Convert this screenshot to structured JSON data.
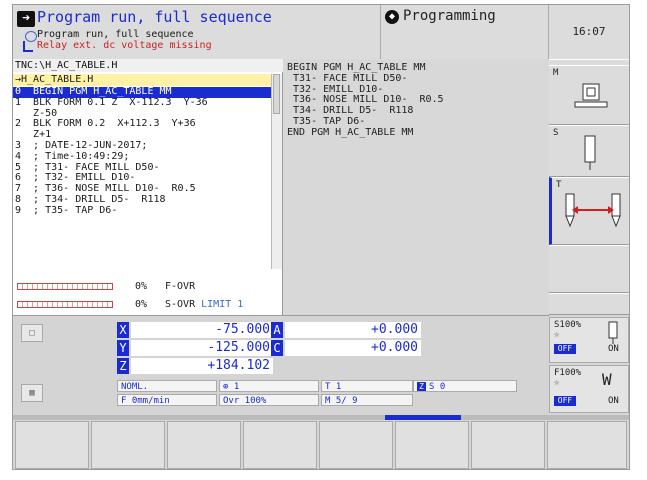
{
  "header": {
    "mode_title": "Program run, full sequence",
    "mode_subtitle": "Program run, full sequence",
    "error_message": "Relay ext. dc voltage missing",
    "secondary_mode": "Programming",
    "clock": "16:07"
  },
  "program": {
    "path": "TNC:\\H_AC_TABLE.H",
    "file": "→H_AC_TABLE.H",
    "lines": [
      "0  BEGIN PGM H_AC_TABLE MM",
      "1  BLK FORM 0.1 Z  X-112.3  Y-36",
      "   Z-50",
      "2  BLK FORM 0.2  X+112.3  Y+36",
      "   Z+1",
      "3  ; DATE-12-JUN-2017;",
      "4  ; Time-10:49:29;",
      "5  ; T31- FACE MILL D50-",
      "6  ; T32- EMILL D10-",
      "7  ; T36- NOSE MILL D10-  R0.5",
      "8  ; T34- DRILL D5-  R118",
      "9  ; T35- TAP D6-"
    ]
  },
  "overrides": {
    "f_pct": "0%",
    "f_name": "F-OVR",
    "s_pct": "0%",
    "s_name": "S-OVR",
    "s_limit": "LIMIT 1"
  },
  "pgm_view": {
    "lines": [
      "BEGIN PGM H_AC_TABLE MM",
      " T31- FACE MILL D50-",
      " T32- EMILL D10-",
      " T36- NOSE MILL D10-  R0.5",
      " T34- DRILL D5-  R118",
      " T35- TAP D6-",
      "END PGM H_AC_TABLE MM"
    ]
  },
  "positions": {
    "x_label": "X",
    "x_value": "-75.000",
    "y_label": "Y",
    "y_value": "-125.000",
    "z_label": "Z",
    "z_value": "+184.102",
    "a_label": "A",
    "a_value": "+0.000",
    "c_label": "C",
    "c_value": "+0.000"
  },
  "status": {
    "mode": "NOML.",
    "datum": "1",
    "tool": "T 1",
    "axis": "Z",
    "spindle": "S   0",
    "feed": "F  0mm/min",
    "ovr": "Ovr  100%",
    "mfunc": "M  5/ 9"
  },
  "softkeys_right": {
    "m_label": "M",
    "s_label": "S",
    "t_label": "T",
    "s100": "S100%",
    "f100": "F100%",
    "off": "OFF",
    "on": "ON"
  }
}
